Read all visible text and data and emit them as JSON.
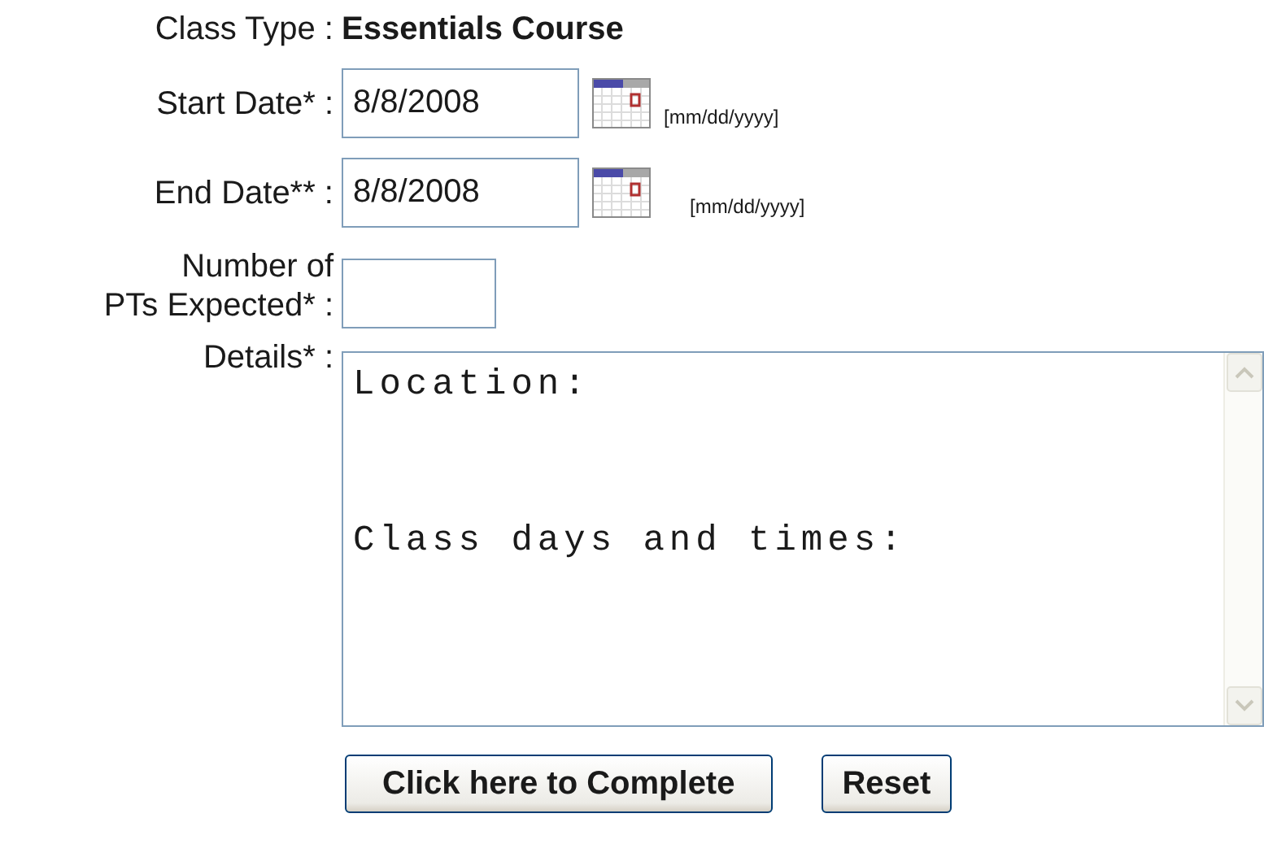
{
  "fields": [
    {
      "kind": "static",
      "label": "Class Type :",
      "value": "Essentials Course"
    },
    {
      "kind": "date",
      "label": "Start Date* :",
      "value": "8/8/2008",
      "hint": "[mm/dd/yyyy]"
    },
    {
      "kind": "date",
      "label": "End Date** :",
      "value": "8/8/2008",
      "hint": "[mm/dd/yyyy]"
    },
    {
      "kind": "number",
      "label": "Number of\nPTs Expected* :"
    },
    {
      "kind": "textarea",
      "label": "Details* :",
      "value": "Location:\n\n\nClass days and times:"
    }
  ],
  "buttons": [
    "Click here to Complete",
    "Reset"
  ]
}
